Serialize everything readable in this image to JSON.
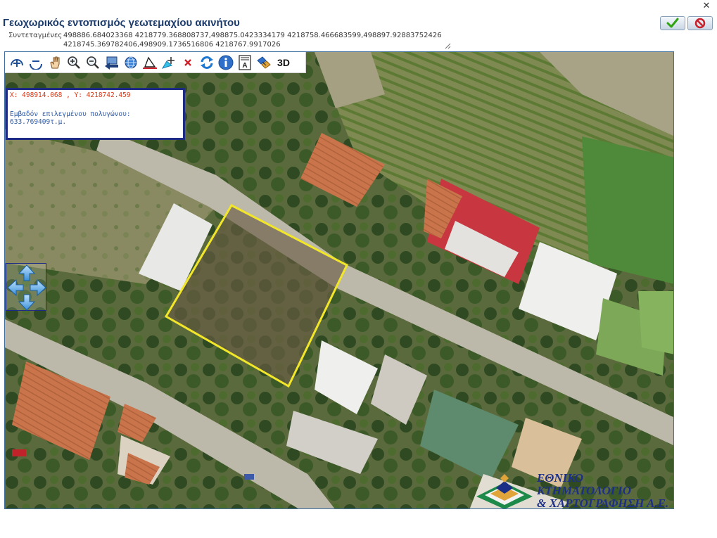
{
  "window": {
    "title": "Γεωχωρικός εντοπισμός γεωτεμαχίου ακινήτου",
    "close_icon": "close-icon"
  },
  "actions": {
    "ok_icon": "checkmark-icon",
    "cancel_icon": "no-entry-icon",
    "ok_color": "#2fa312",
    "cancel_color": "#c8202a"
  },
  "coordinates": {
    "label": "Συντεταγμένες",
    "value": "498886.684023368 4218779.368808737,498875.0423334179 4218758.466683599,498897.92883752426 4218745.369782406,498909.1736516806 4218767.9917026"
  },
  "toolbar": {
    "tools": [
      {
        "name": "zoom-in-plus-icon"
      },
      {
        "name": "zoom-out-minus-icon"
      },
      {
        "name": "pan-hand-icon"
      },
      {
        "name": "zoom-in-magnifier-icon"
      },
      {
        "name": "zoom-out-magnifier-icon"
      },
      {
        "name": "previous-extent-icon"
      },
      {
        "name": "full-extent-globe-icon"
      },
      {
        "name": "measure-polygon-icon"
      },
      {
        "name": "draw-polygon-icon"
      },
      {
        "name": "clear-icon"
      },
      {
        "name": "refresh-icon"
      },
      {
        "name": "info-icon"
      },
      {
        "name": "legend-icon"
      },
      {
        "name": "layers-icon"
      }
    ],
    "label_3d": "3D"
  },
  "info_box": {
    "xy": "X: 498914.068 , Y: 4218742.459",
    "area_label": "Εμβαδόν επιλεγμένου πολυγώνου:",
    "area_value": "633.769409τ.μ."
  },
  "map": {
    "parcel_outline_color": "#f2e62a",
    "pan_control_icon": "pan-arrows-icon"
  },
  "logo": {
    "line1": "ΕΘΝΙΚΟ ΚΤΗΜΑΤΟΛΟΓΙΟ",
    "line2": "& ΧΑΡΤΟΓΡΑΦΗΣΗ Α.Ε."
  }
}
